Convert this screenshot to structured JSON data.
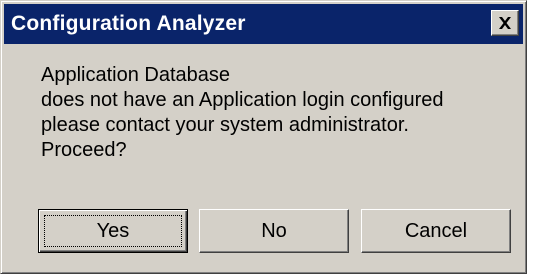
{
  "window": {
    "title": "Configuration Analyzer",
    "close_icon": "close-icon"
  },
  "message": {
    "lines": [
      "Application Database",
      "does not have an Application login configured",
      "please contact your system administrator.",
      "Proceed?"
    ]
  },
  "buttons": {
    "yes": "Yes",
    "no": "No",
    "cancel": "Cancel",
    "default": "yes"
  },
  "colors": {
    "titlebar": "#0a246a",
    "face": "#d4d0c8",
    "title_text": "#ffffff"
  }
}
